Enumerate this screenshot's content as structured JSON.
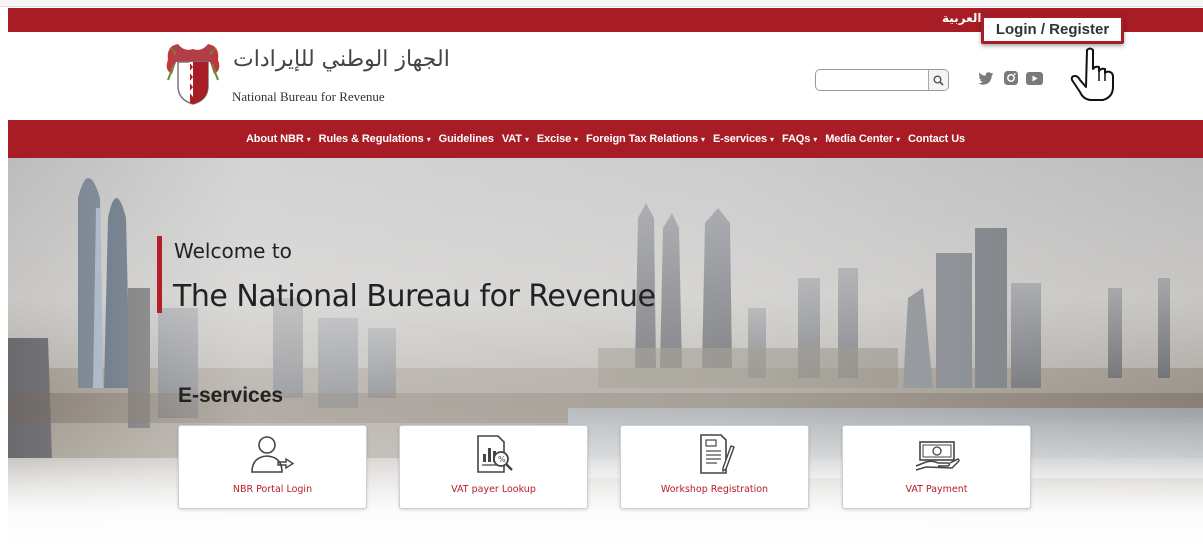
{
  "topbar": {
    "language_link": "العربية",
    "login_button": "Login / Register"
  },
  "header": {
    "logo_arabic": "الجهاز الوطني للإيرادات",
    "logo_english": "National Bureau for Revenue",
    "search": {
      "value": "",
      "placeholder": ""
    },
    "social_icons": [
      "twitter-icon",
      "instagram-icon",
      "youtube-icon"
    ]
  },
  "nav": {
    "items": [
      {
        "label": "About NBR",
        "dropdown": true
      },
      {
        "label": "Rules & Regulations",
        "dropdown": true
      },
      {
        "label": "Guidelines",
        "dropdown": false
      },
      {
        "label": "VAT",
        "dropdown": true
      },
      {
        "label": "Excise",
        "dropdown": true
      },
      {
        "label": "Foreign Tax Relations",
        "dropdown": true
      },
      {
        "label": "E-services",
        "dropdown": true
      },
      {
        "label": "FAQs",
        "dropdown": true
      },
      {
        "label": "Media Center",
        "dropdown": true
      },
      {
        "label": "Contact Us",
        "dropdown": false
      }
    ]
  },
  "hero": {
    "welcome_small": "Welcome to",
    "welcome_big": "The National Bureau for Revenue"
  },
  "eservices": {
    "title": "E-services",
    "cards": [
      {
        "label": "NBR Portal Login",
        "icon": "user-login-icon"
      },
      {
        "label": "VAT payer Lookup",
        "icon": "document-search-icon"
      },
      {
        "label": "Workshop Registration",
        "icon": "document-edit-icon"
      },
      {
        "label": "VAT Payment",
        "icon": "cash-payment-icon"
      }
    ]
  },
  "colors": {
    "brand_red": "#a71c25",
    "accent_red": "#b71d27",
    "text_dark": "#222222"
  }
}
